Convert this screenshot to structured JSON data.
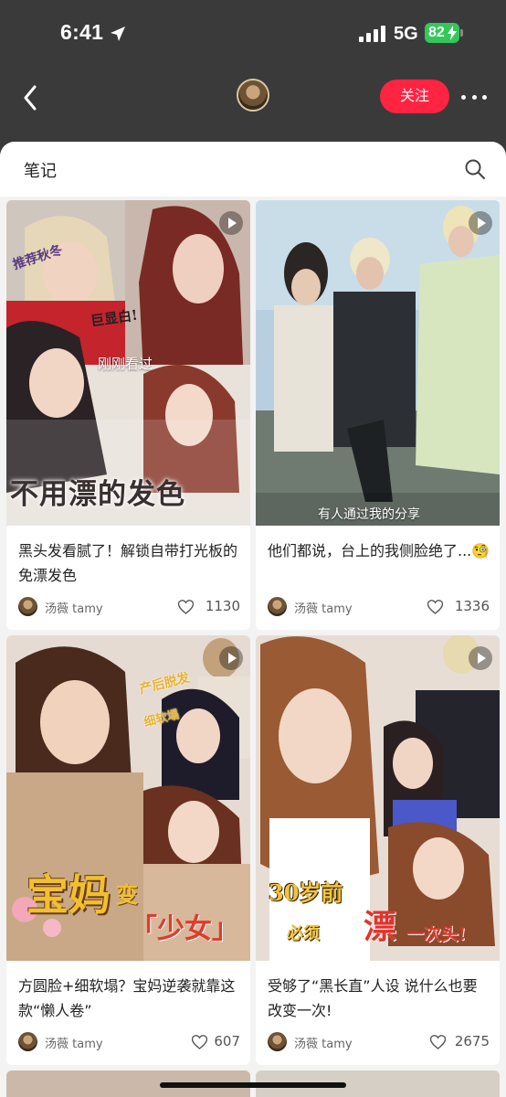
{
  "status_bar": {
    "time": "6:41",
    "network": "5G",
    "battery": "82"
  },
  "nav": {
    "follow_label": "关注"
  },
  "section": {
    "title": "笔记"
  },
  "colors": {
    "accent": "#ff2442",
    "battery": "#34c759"
  },
  "icons": [
    "location-arrow-icon",
    "signal-icon",
    "battery-icon",
    "back-icon",
    "more-icon",
    "search-icon",
    "play-icon",
    "heart-icon"
  ],
  "notes": [
    {
      "title": "黑头发看腻了！解锁自带打光板的免漂发色",
      "author": "汤薇 tamy",
      "likes": "1130",
      "overlay": "刚刚看过",
      "cover_texts": [
        "推荐秋冬",
        "巨显白!",
        "不用漂的发色"
      ]
    },
    {
      "title": "他们都说，台上的我侧脸绝了...🧐",
      "author": "汤薇 tamy",
      "likes": "1336",
      "overlay": "有人通过我的分享",
      "cover_texts": []
    },
    {
      "title": "方圆脸+细软塌？宝妈逆袭就靠这款“懒人卷”",
      "author": "汤薇 tamy",
      "likes": "607",
      "overlay": "",
      "cover_texts": [
        "产后脱发",
        "细软塌",
        "宝妈",
        "变",
        "「少女」"
      ]
    },
    {
      "title": "受够了“黑长直”人设 说什么也要改变一次!",
      "author": "汤薇 tamy",
      "likes": "2675",
      "overlay": "",
      "cover_texts": [
        "30岁前",
        "必须",
        "漂",
        "一次头!"
      ]
    }
  ]
}
